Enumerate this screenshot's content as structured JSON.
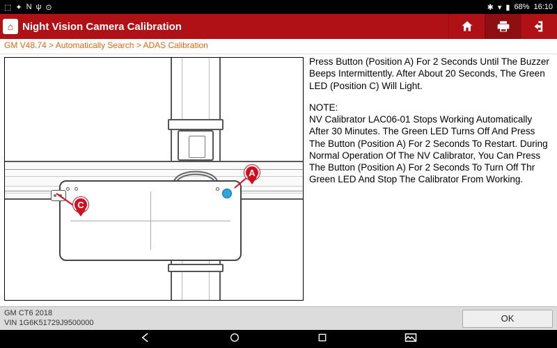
{
  "statusbar": {
    "left_icons": [
      "⬚",
      "✦",
      "N",
      "ψ",
      "⊙"
    ],
    "battery_pct": "68%",
    "time": "16:10"
  },
  "header": {
    "title": "Night Vision Camera Calibration"
  },
  "breadcrumb": "GM V48.74 > Automatically Search > ADAS Calibration",
  "instructions": {
    "p1": "Press Button (Position A) For 2 Seconds Until The Buzzer Beeps Intermittently. After About 20 Seconds, The Green LED (Position C) Will Light.",
    "note_label": "NOTE:",
    "p2": "NV Calibrator LAC06-01 Stops Working Automatically After 30 Minutes. The Green LED Turns Off And Press The Button (Position A) For 2 Seconds To Restart. During Normal Operation Of The NV Calibrator, You Can Press The Button (Position A) For 2 Seconds To Turn Off Thr Green LED And Stop The Calibrator From Working."
  },
  "callouts": {
    "A": "A",
    "C": "C"
  },
  "footer": {
    "vehicle": "GM CT6 2018",
    "vin_label": "VIN 1G6K51729J9500000",
    "ok": "OK"
  }
}
